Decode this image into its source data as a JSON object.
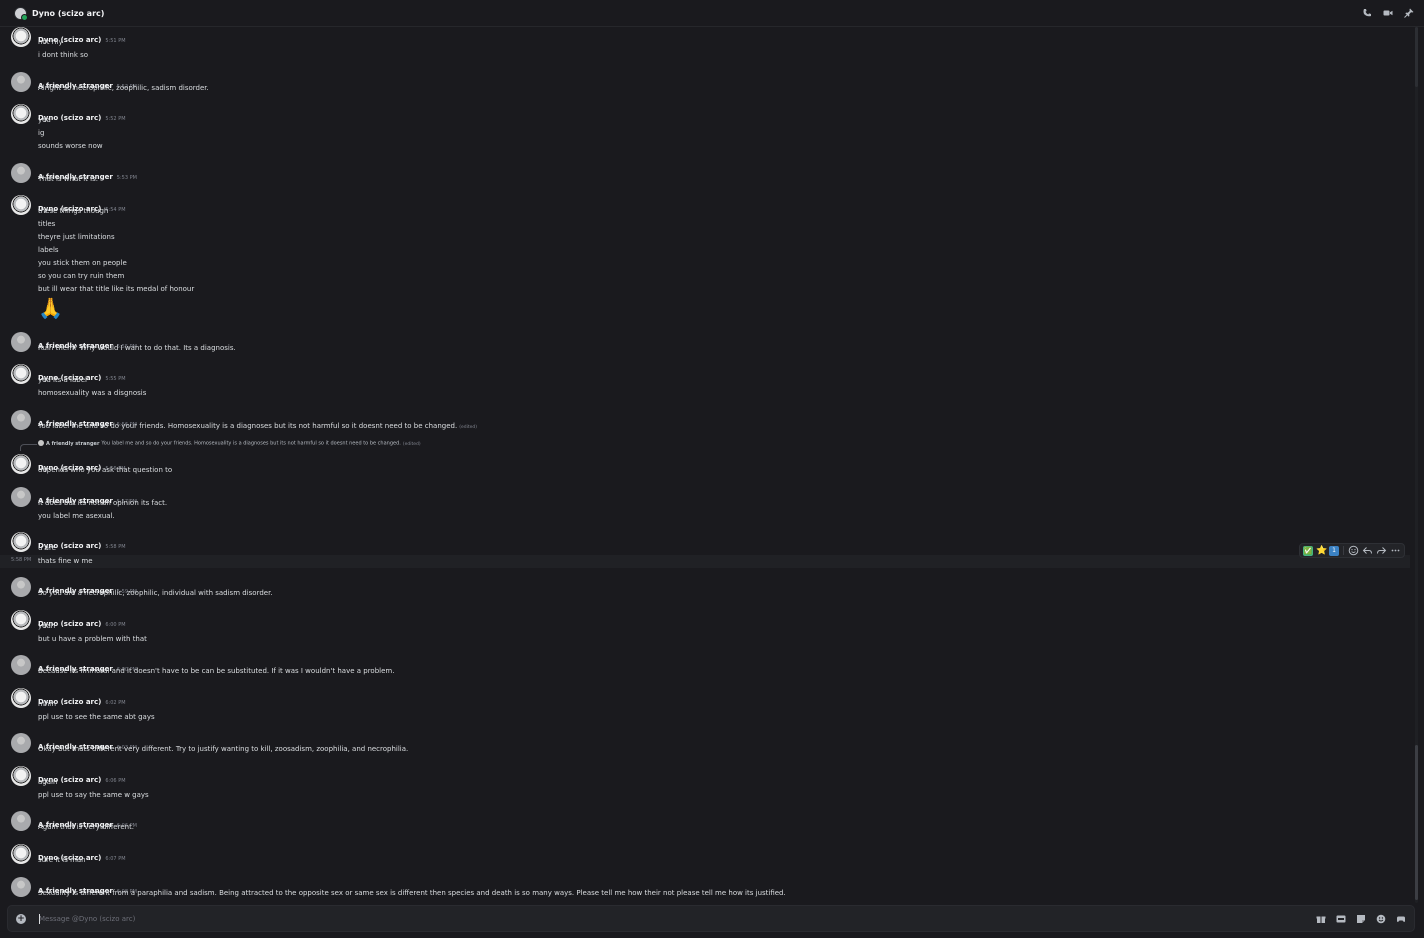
{
  "channel": {
    "title": "Dyno (scizo arc)"
  },
  "composer": {
    "placeholder": "Message @Dyno (scizo arc)"
  },
  "hover": {
    "timestamp": "5:58 PM"
  },
  "reply": {
    "author": "A friendly stranger",
    "text": "You label me and so do your friends. Homosexuality is a diagnoses but its not harmful so it doesnt need to be changed.",
    "edited": "(edited)"
  },
  "reactions": [
    "✅",
    "⭐",
    "1"
  ],
  "big_emoji": "🙏",
  "messages": [
    {
      "author": "Dyno (scizo arc)",
      "time": "5:51 PM",
      "lines": [
        "not rlly",
        "i dont think so"
      ]
    },
    {
      "author": "A friendly stranger",
      "time": "5:52 PM",
      "lines": [
        "Alright so necrophilic, zoophilic, sadism disorder."
      ]
    },
    {
      "author": "Dyno (scizo arc)",
      "time": "5:52 PM",
      "lines": [
        "yea",
        "ig",
        "sounds worse now"
      ]
    },
    {
      "author": "A friendly stranger",
      "time": "5:53 PM",
      "lines": [
        "That is what it is."
      ]
    },
    {
      "author": "Dyno (scizo arc)",
      "time": "5:54 PM",
      "lines": [
        "these things though",
        "titles",
        "theyre just limitations",
        "labels",
        "you stick them on people",
        "so you can try ruin them",
        "but ill wear that title like its medal of honour"
      ]
    },
    {
      "author": "A friendly stranger",
      "time": "5:55 PM",
      "lines": [
        "Ruin them? Why would I want to do that. Its a diagnosis."
      ]
    },
    {
      "author": "Dyno (scizo arc)",
      "time": "5:55 PM",
      "lines": [
        "yea its a label",
        "homosexuality was a disgnosis"
      ]
    },
    {
      "author": "A friendly stranger",
      "time": "5:56 PM",
      "lines": [
        "You label me and so do your friends. Homosexuality is a diagnoses but its not harmful so it doesnt need to be changed."
      ],
      "edited": "(edited)"
    },
    {
      "author": "Dyno (scizo arc)",
      "time": "5:56 PM",
      "lines": [
        "depends who you ask that question to"
      ]
    },
    {
      "author": "A friendly stranger",
      "time": "5:57 PM",
      "lines": [
        "It does but its not an opinion its fact.",
        "you label me asexual."
      ]
    },
    {
      "author": "Dyno (scizo arc)",
      "time": "5:58 PM",
      "lines": [
        "u are",
        "thats fine w me"
      ]
    },
    {
      "author": "A friendly stranger",
      "time": "5:59 PM",
      "lines": [
        "So you are a necrophilic, zoophilic, individual with sadism disorder."
      ]
    },
    {
      "author": "Dyno (scizo arc)",
      "time": "6:00 PM",
      "lines": [
        "yeah",
        "but u have a problem with that"
      ]
    },
    {
      "author": "A friendly stranger",
      "time": "6:00 PM",
      "lines": [
        "Because its immoral and it doesn't have to be can be substituted. If it was I wouldn't have a problem."
      ]
    },
    {
      "author": "Dyno (scizo arc)",
      "time": "6:02 PM",
      "lines": [
        "mhm",
        "ppl use to see the same abt gays"
      ]
    },
    {
      "author": "A friendly stranger",
      "time": "6:03 PM",
      "lines": [
        "Okay but thats different very different. Try to justify wanting to kill, zoosadism, zoophilia, and necrophilia."
      ]
    },
    {
      "author": "Dyno (scizo arc)",
      "time": "6:06 PM",
      "lines": [
        "again",
        "ppl use to say the same w gays"
      ]
    },
    {
      "author": "A friendly stranger",
      "time": "6:06 PM",
      "lines": [
        "Again that is very different."
      ]
    },
    {
      "author": "Dyno (scizo arc)",
      "time": "6:07 PM",
      "lines": [
        "sure it is man"
      ]
    },
    {
      "author": "A friendly stranger",
      "time": "6:08 PM",
      "lines": [
        "Sexuality is different from a paraphilia and sadism. Being attracted to the opposite sex or same sex is different then species and death is so many ways. Please tell me how their not please tell me how its justified."
      ]
    }
  ]
}
